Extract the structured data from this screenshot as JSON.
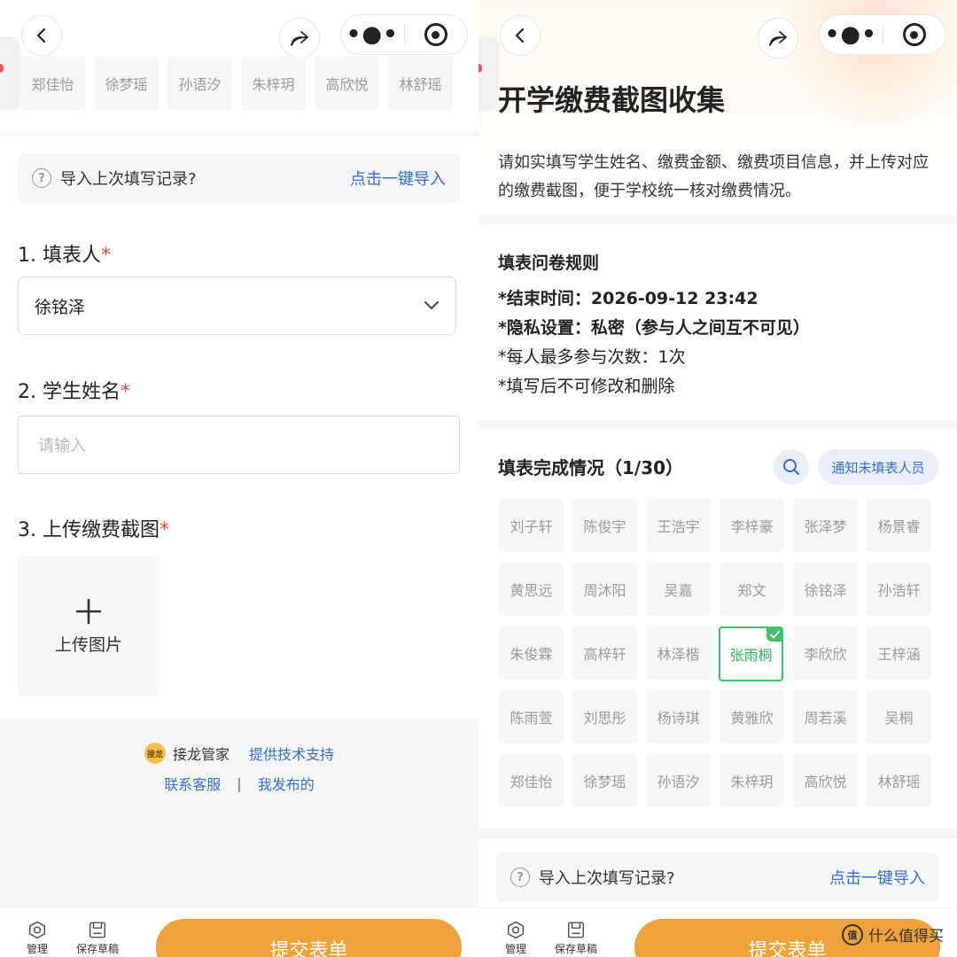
{
  "common": {
    "import_text": "导入上次填写记录?",
    "import_link": "点击一键导入",
    "submit_label": "提交表单",
    "bottom_manage": "管理",
    "bottom_save": "保存草稿"
  },
  "left": {
    "top_names": [
      "郑佳怡",
      "徐梦瑶",
      "孙语汐",
      "朱梓玥",
      "高欣悦",
      "林舒瑶"
    ],
    "q1_label": "1. 填表人",
    "q1_value": "徐铭泽",
    "q2_label": "2. 学生姓名",
    "q2_placeholder": "请输入",
    "q3_label": "3. 上传缴费截图",
    "upload_label": "上传图片",
    "required_mark": "*",
    "brand_logo": "接龙",
    "brand_name": "接龙管家",
    "tech_support": "提供技术支持",
    "contact": "联系客服",
    "separator": "|",
    "my_published": "我发布的"
  },
  "right": {
    "title": "开学缴费截图收集",
    "description": "请如实填写学生姓名、缴费金额、缴费项目信息，并上传对应的缴费截图，便于学校统一核对缴费情况。",
    "rules_title": "填表问卷规则",
    "rule_end_time": "*结束时间：2026-09-12 23:42",
    "rule_privacy": "*隐私设置：私密（参与人之间互不可见）",
    "rule_max": "*每人最多参与次数：1次",
    "rule_no_edit": "*填写后不可修改和删除",
    "progress_title": "填表完成情况（1/30）",
    "notify_label": "通知未填表人员",
    "names": [
      "刘子轩",
      "陈俊宇",
      "王浩宇",
      "李梓豪",
      "张泽梦",
      "杨景睿",
      "黄思远",
      "周沐阳",
      "吴嘉",
      "郑文",
      "徐铭泽",
      "孙浩轩",
      "朱俊霖",
      "高梓轩",
      "林泽楷",
      "张雨桐",
      "李欣欣",
      "王梓涵",
      "陈雨萱",
      "刘思彤",
      "杨诗琪",
      "黄雅欣",
      "周若溪",
      "吴桐",
      "郑佳怡",
      "徐梦瑶",
      "孙语汐",
      "朱梓玥",
      "高欣悦",
      "林舒瑶"
    ],
    "completed_index": 15,
    "watermark_logo": "值",
    "watermark_text": "什么值得买"
  },
  "colors": {
    "accent_orange": "#f0a23a",
    "link_blue": "#2f6fd6",
    "done_green": "#3ec26a",
    "required_red": "#e84b3a"
  }
}
